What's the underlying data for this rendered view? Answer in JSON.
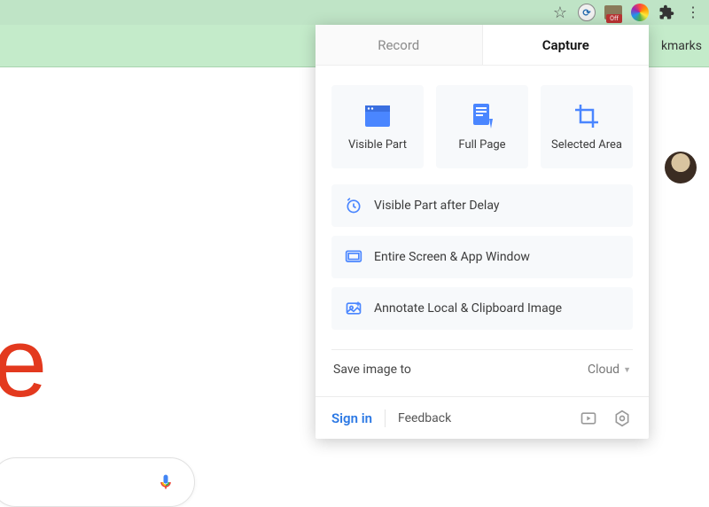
{
  "toolbar": {
    "folder_badge": "Off"
  },
  "bookmarks": {
    "label_partial": "kmarks"
  },
  "popup": {
    "tabs": {
      "record": "Record",
      "capture": "Capture"
    },
    "cards": {
      "visible_part": "Visible Part",
      "full_page": "Full Page",
      "selected_area": "Selected Area"
    },
    "rows": {
      "delay": "Visible Part after Delay",
      "entire": "Entire Screen & App Window",
      "annotate": "Annotate Local & Clipboard Image"
    },
    "save": {
      "label": "Save image to",
      "dest": "Cloud"
    },
    "footer": {
      "signin": "Sign in",
      "feedback": "Feedback"
    }
  },
  "google": {
    "logo_fragment": "e"
  }
}
